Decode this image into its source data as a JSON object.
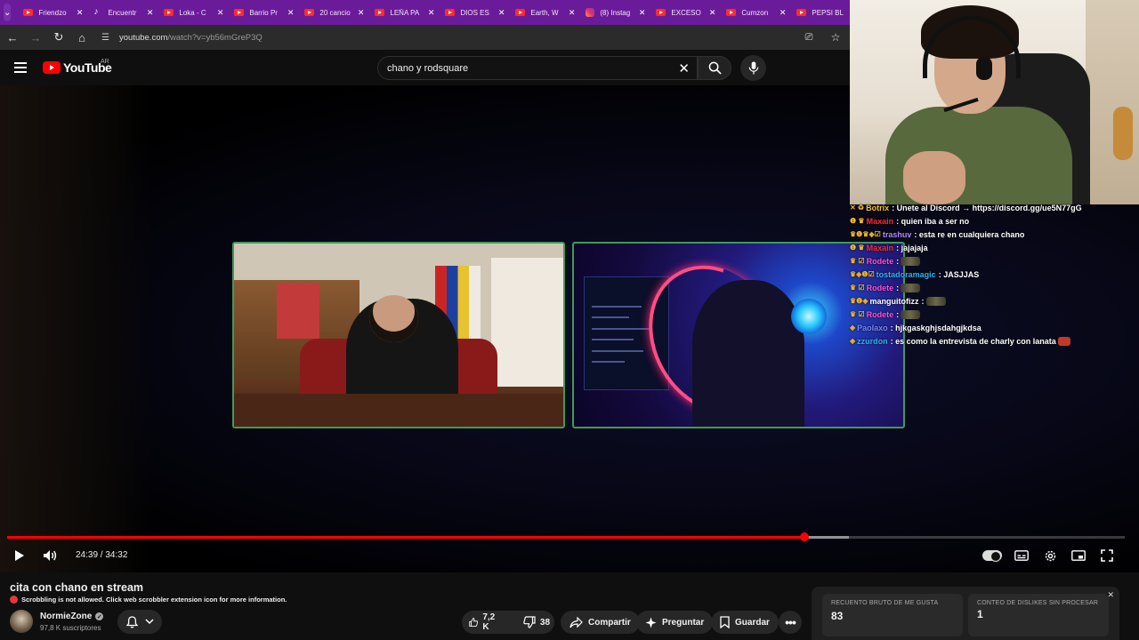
{
  "browser": {
    "tabs": [
      {
        "title": "Friendzo",
        "icon": "youtube-icon"
      },
      {
        "title": "Encuentr",
        "icon": "tiktok-icon"
      },
      {
        "title": "Loka - C",
        "icon": "youtube-icon"
      },
      {
        "title": "Barrio Pr",
        "icon": "youtube-icon"
      },
      {
        "title": "20 cancio",
        "icon": "youtube-icon"
      },
      {
        "title": "LEÑA PA",
        "icon": "youtube-icon"
      },
      {
        "title": "DIOS ES",
        "icon": "youtube-icon"
      },
      {
        "title": "Earth, W",
        "icon": "youtube-icon"
      },
      {
        "title": "(8) Instag",
        "icon": "instagram-icon"
      },
      {
        "title": "EXCESO",
        "icon": "youtube-icon"
      },
      {
        "title": "Cumzon",
        "icon": "youtube-icon"
      },
      {
        "title": "PEPSI BL",
        "icon": "youtube-icon"
      }
    ],
    "url_host": "youtube.com",
    "url_path": "/watch?v=yb56mGreP3Q"
  },
  "youtube": {
    "logo_word": "YouTube",
    "country": "AR",
    "search_query": "chano y rodsquare"
  },
  "player": {
    "time": "24:39 / 34:32",
    "progress_fraction": 0.7137,
    "buffer_fraction": 0.7531
  },
  "chat": [
    {
      "badges": "✕ ♻",
      "user": "Botrix",
      "user_color": "#f5c518",
      "text": ": Unete al Discord → https://discord.gg/ue5N77gG",
      "emote": ""
    },
    {
      "badges": "❶ ♛",
      "user": "Maxain",
      "user_color": "#ff2d2d",
      "text": ": quien iba a ser no",
      "emote": ""
    },
    {
      "badges": "♛❶♛◈☑",
      "user": "trashuv",
      "user_color": "#b388ff",
      "text": ": esta re en cualquiera chano",
      "emote": ""
    },
    {
      "badges": "❶ ♛",
      "user": "Maxain",
      "user_color": "#ff2d2d",
      "text": ": jajajaja",
      "emote": ""
    },
    {
      "badges": "♛ ☑",
      "user": "Rodete",
      "user_color": "#ff4fd8",
      "text": ":",
      "emote": "tank"
    },
    {
      "badges": "♛◈❶☑",
      "user": "tostadoramagic",
      "user_color": "#29b6f6",
      "text": ": JASJJAS",
      "emote": ""
    },
    {
      "badges": "♛ ☑",
      "user": "Rodete",
      "user_color": "#ff4fd8",
      "text": ":",
      "emote": "tank"
    },
    {
      "badges": "♛❶◈",
      "user": "manguitofizz",
      "user_color": "#ffffff",
      "text": ":",
      "emote": "tank"
    },
    {
      "badges": "♛ ☑",
      "user": "Rodete",
      "user_color": "#ff4fd8",
      "text": ":",
      "emote": "tank"
    },
    {
      "badges": "◈",
      "user": "Paolaxo",
      "user_color": "#7c83ff",
      "text": ": hjkgaskghjsdahgjkdsa",
      "emote": ""
    },
    {
      "badges": "◈",
      "user": "zzurdon",
      "user_color": "#29b6f6",
      "text": ": es como la entrevista de charly con lanata",
      "emote": "red"
    }
  ],
  "video": {
    "title": "cita con chano en stream",
    "scrobble_notice": "Scrobbling is not allowed. Click web scrobbler extension icon for more information.",
    "channel": "NormieZone",
    "subscribers": "97,8 K suscriptores",
    "likes": "7,2 K",
    "dislikes": "38",
    "share_label": "Compartir",
    "ask_label": "Preguntar",
    "save_label": "Guardar"
  },
  "stats_panel": {
    "likes_label": "RECUENTO BRUTO DE ME GUSTA",
    "likes_value": "83",
    "dislikes_label": "CONTEO DE DISLIKES SIN PROCESAR",
    "dislikes_value": "1"
  },
  "colors": {
    "tabstrip": "#6a1b9a",
    "progress": "#ff0000",
    "cam_border": "#3f9a59"
  }
}
